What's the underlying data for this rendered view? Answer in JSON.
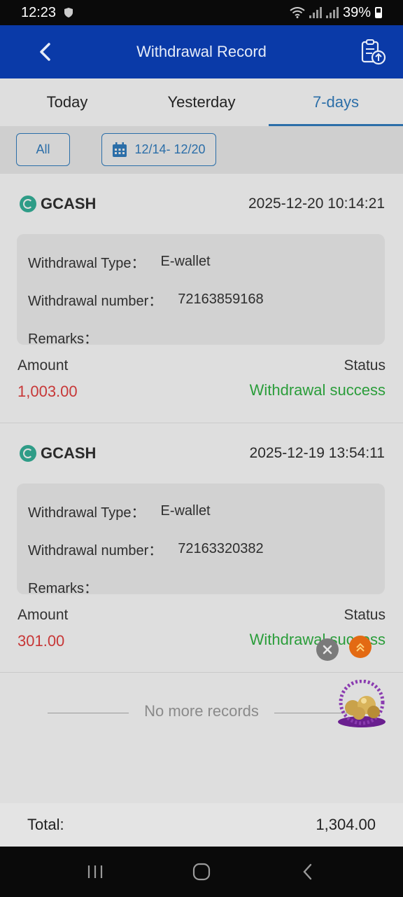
{
  "status_bar": {
    "time": "12:23",
    "battery": "39%"
  },
  "header": {
    "title": "Withdrawal Record",
    "back_icon": "chevron-left-icon",
    "action_icon": "clipboard-upload-icon"
  },
  "tabs": [
    {
      "label": "Today",
      "active": false
    },
    {
      "label": "Yesterday",
      "active": false
    },
    {
      "label": "7-days",
      "active": true
    }
  ],
  "filters": {
    "all_label": "All",
    "date_range": "12/14- 12/20"
  },
  "records": [
    {
      "method": "GCASH",
      "datetime": "2025-12-20 10:14:21",
      "type_label": "Withdrawal Type：",
      "type_value": "E-wallet",
      "number_label": "Withdrawal number：",
      "number_value": "72163859168",
      "remarks_label": "Remarks：",
      "amount_label": "Amount",
      "amount": "1,003.00",
      "status_label": "Status",
      "status": "Withdrawal success"
    },
    {
      "method": "GCASH",
      "datetime": "2025-12-19 13:54:11",
      "type_label": "Withdrawal Type：",
      "type_value": "E-wallet",
      "number_label": "Withdrawal number：",
      "number_value": "72163320382",
      "remarks_label": "Remarks：",
      "amount_label": "Amount",
      "amount": "301.00",
      "status_label": "Status",
      "status": "Withdrawal success"
    }
  ],
  "no_more_text": "No more records",
  "total": {
    "label": "Total:",
    "value": "1,304.00"
  },
  "colors": {
    "header": "#0a3aa8",
    "active_tab": "#2b6ea8",
    "amount": "#c73737",
    "success": "#2a9d3a",
    "gcash": "#2e9c87"
  }
}
